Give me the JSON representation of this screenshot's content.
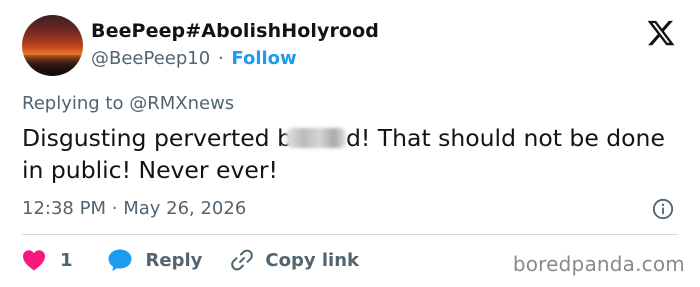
{
  "author": {
    "display_name": "BeePeep#AbolishHolyrood",
    "handle": "@BeePeep10",
    "separator": "·",
    "follow_label": "Follow"
  },
  "reply_context": {
    "prefix": "Replying to",
    "mention": "@RMXnews"
  },
  "tweet": {
    "text_before_blur": "Disgusting perverted b",
    "text_after_blur": "d! That should not be done in public! Never ever!"
  },
  "timestamp": {
    "time": "12:38 PM",
    "separator": "·",
    "date": "May 26, 2026"
  },
  "actions": {
    "like_count": "1",
    "reply_label": "Reply",
    "copy_link_label": "Copy link"
  },
  "watermark": "boredpanda.com",
  "icons": {
    "brand": "x-logo-icon",
    "info": "info-icon",
    "like": "heart-icon",
    "reply": "chat-bubble-icon",
    "copy": "link-icon"
  },
  "colors": {
    "accent": "#1d9bf0",
    "like": "#f91880",
    "muted": "#536471",
    "text": "#0f1419"
  }
}
